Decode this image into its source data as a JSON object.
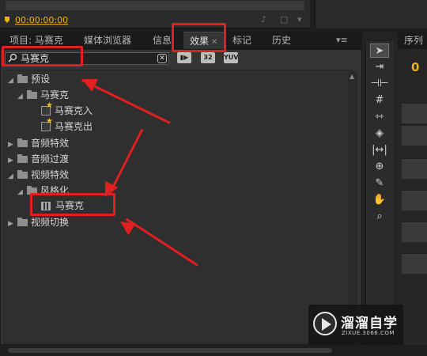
{
  "top": {
    "timecode": "00:00:00:00"
  },
  "tabs": [
    {
      "label": "项目: 马赛克",
      "active": false
    },
    {
      "label": "媒体浏览器",
      "active": false
    },
    {
      "label": "信息",
      "active": false
    },
    {
      "label": "效果",
      "active": true
    },
    {
      "label": "标记",
      "active": false
    },
    {
      "label": "历史",
      "active": false
    }
  ],
  "right_tab": {
    "label": "序列"
  },
  "search": {
    "value": "马赛克",
    "clear_icon": "close-icon"
  },
  "filter_buttons": [
    "accelerated-effects-icon",
    "32",
    "YUV"
  ],
  "tree": [
    {
      "label": "预设",
      "type": "folder",
      "expanded": true,
      "level": 0
    },
    {
      "label": "马赛克",
      "type": "folder",
      "expanded": true,
      "level": 1
    },
    {
      "label": "马赛克入",
      "type": "preset",
      "level": 2
    },
    {
      "label": "马赛克出",
      "type": "preset",
      "level": 2
    },
    {
      "label": "音频特效",
      "type": "folder",
      "expanded": false,
      "level": 0
    },
    {
      "label": "音频过渡",
      "type": "folder",
      "expanded": false,
      "level": 0
    },
    {
      "label": "视频特效",
      "type": "folder",
      "expanded": true,
      "level": 0
    },
    {
      "label": "风格化",
      "type": "folder",
      "expanded": true,
      "level": 1
    },
    {
      "label": "马赛克",
      "type": "effect",
      "level": 2,
      "highlighted": true
    },
    {
      "label": "视频切换",
      "type": "folder",
      "expanded": false,
      "level": 0
    }
  ],
  "tools": [
    "selection-tool-icon",
    "track-select-tool-icon",
    "ripple-edit-tool-icon",
    "rolling-edit-tool-icon",
    "rate-stretch-tool-icon",
    "razor-tool-icon",
    "slip-tool-icon",
    "slide-tool-icon",
    "pen-tool-icon",
    "hand-tool-icon",
    "zoom-tool-icon"
  ],
  "watermark": {
    "title": "溜溜自学",
    "subtitle": "ZIXUE.3066.COM"
  },
  "colors": {
    "annotation": "#e02020",
    "timecode": "#e9b40c",
    "panel": "#343434"
  }
}
